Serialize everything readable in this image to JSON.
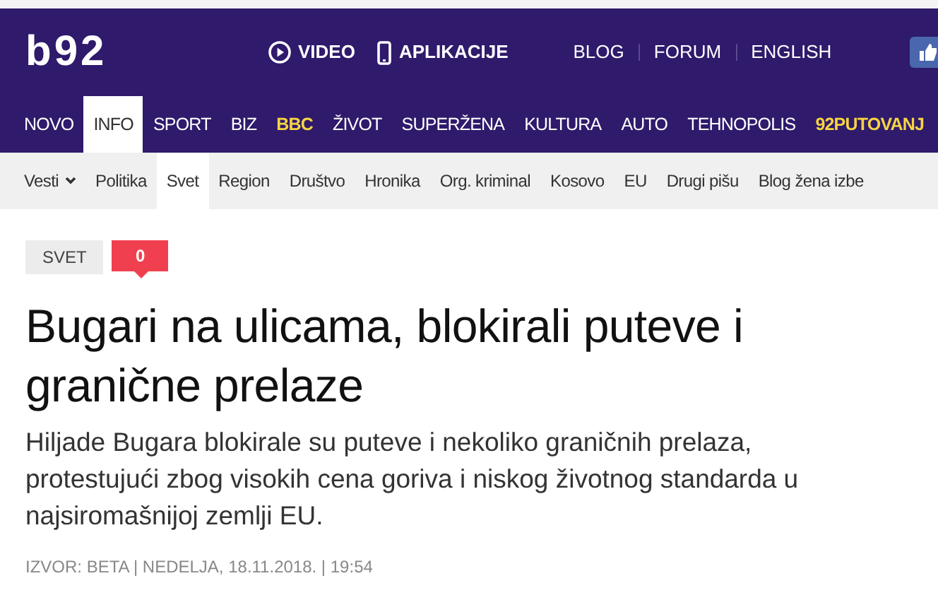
{
  "header": {
    "logo": "b92",
    "media_links": [
      {
        "kind": "video",
        "label": "VIDEO"
      },
      {
        "kind": "apps",
        "label": "APLIKACIJE"
      }
    ],
    "links": [
      "BLOG",
      "FORUM",
      "ENGLISH"
    ]
  },
  "nav": [
    {
      "label": "NOVO",
      "selected": false,
      "kind": "plain"
    },
    {
      "label": "INFO",
      "selected": true,
      "kind": "plain"
    },
    {
      "label": "SPORT",
      "selected": false,
      "kind": "plain"
    },
    {
      "label": "BIZ",
      "selected": false,
      "kind": "plain"
    },
    {
      "label": "BBC",
      "selected": false,
      "kind": "featured"
    },
    {
      "label": "ŽIVOT",
      "selected": false,
      "kind": "plain"
    },
    {
      "label": "SUPERŽENA",
      "selected": false,
      "kind": "plain"
    },
    {
      "label": "KULTURA",
      "selected": false,
      "kind": "plain"
    },
    {
      "label": "AUTO",
      "selected": false,
      "kind": "plain"
    },
    {
      "label": "TEHNOPOLIS",
      "selected": false,
      "kind": "plain"
    },
    {
      "label": "92PUTOVANJ",
      "selected": false,
      "kind": "featured"
    }
  ],
  "subnav": [
    {
      "label": "Vesti",
      "selected": false,
      "dropdown": true
    },
    {
      "label": "Politika",
      "selected": false,
      "dropdown": false
    },
    {
      "label": "Svet",
      "selected": true,
      "dropdown": false
    },
    {
      "label": "Region",
      "selected": false,
      "dropdown": false
    },
    {
      "label": "Društvo",
      "selected": false,
      "dropdown": false
    },
    {
      "label": "Hronika",
      "selected": false,
      "dropdown": false
    },
    {
      "label": "Org. kriminal",
      "selected": false,
      "dropdown": false
    },
    {
      "label": "Kosovo",
      "selected": false,
      "dropdown": false
    },
    {
      "label": "EU",
      "selected": false,
      "dropdown": false
    },
    {
      "label": "Drugi pišu",
      "selected": false,
      "dropdown": false
    },
    {
      "label": "Blog žena izbe",
      "selected": false,
      "dropdown": false
    }
  ],
  "article": {
    "category": "SVET",
    "comments": "0",
    "title": "Bugari na ulicama, blokirali puteve i granične prelaze",
    "lead": "Hiljade Bugara blokirale su puteve i nekoliko graničnih prelaza, protestujući zbog visokih cena goriva i niskog životnog standarda u najsiromašnijoj zemlji EU.",
    "meta": "IZVOR: BETA | NEDELJA, 18.11.2018. | 19:54"
  }
}
